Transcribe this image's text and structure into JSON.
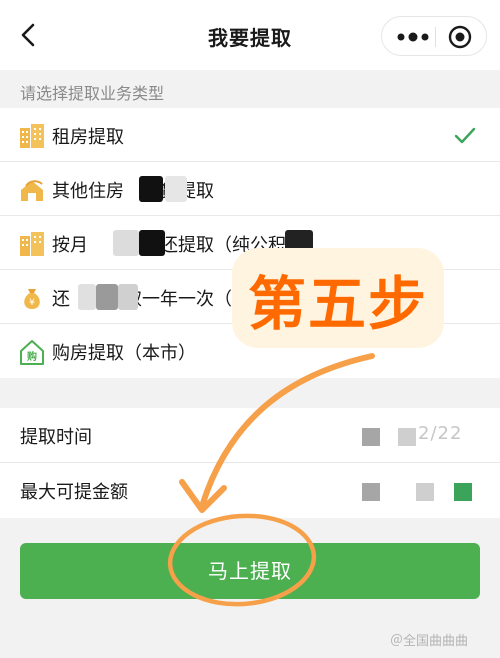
{
  "nav": {
    "title": "我要提取"
  },
  "section_hint": "请选择提取业务类型",
  "options": [
    {
      "label": "租房提取",
      "icon": "building-icon",
      "selected": true
    },
    {
      "label": "其他住房　　贷提取",
      "icon": "house-loan-icon",
      "selected": false
    },
    {
      "label": "按月　　　　还提取（纯公积",
      "icon": "building-icon",
      "selected": false
    },
    {
      "label": "还　　　取一年一次（",
      "icon": "money-bag-icon",
      "selected": false
    },
    {
      "label": "购房提取（本市）",
      "icon": "buy-house-icon",
      "selected": false
    }
  ],
  "form": {
    "withdraw_time_label": "提取时间",
    "withdraw_time_value_faint": "2/22",
    "max_amount_label": "最大可提金额"
  },
  "submit_label": "马上提取",
  "overlay": {
    "step_text": "第五步"
  },
  "watermark": "＠全国曲曲曲",
  "colors": {
    "accent_green": "#4caf50",
    "check_green": "#3aa55a",
    "step_orange": "#ff6a00",
    "arrow_orange": "#f6a04a"
  }
}
